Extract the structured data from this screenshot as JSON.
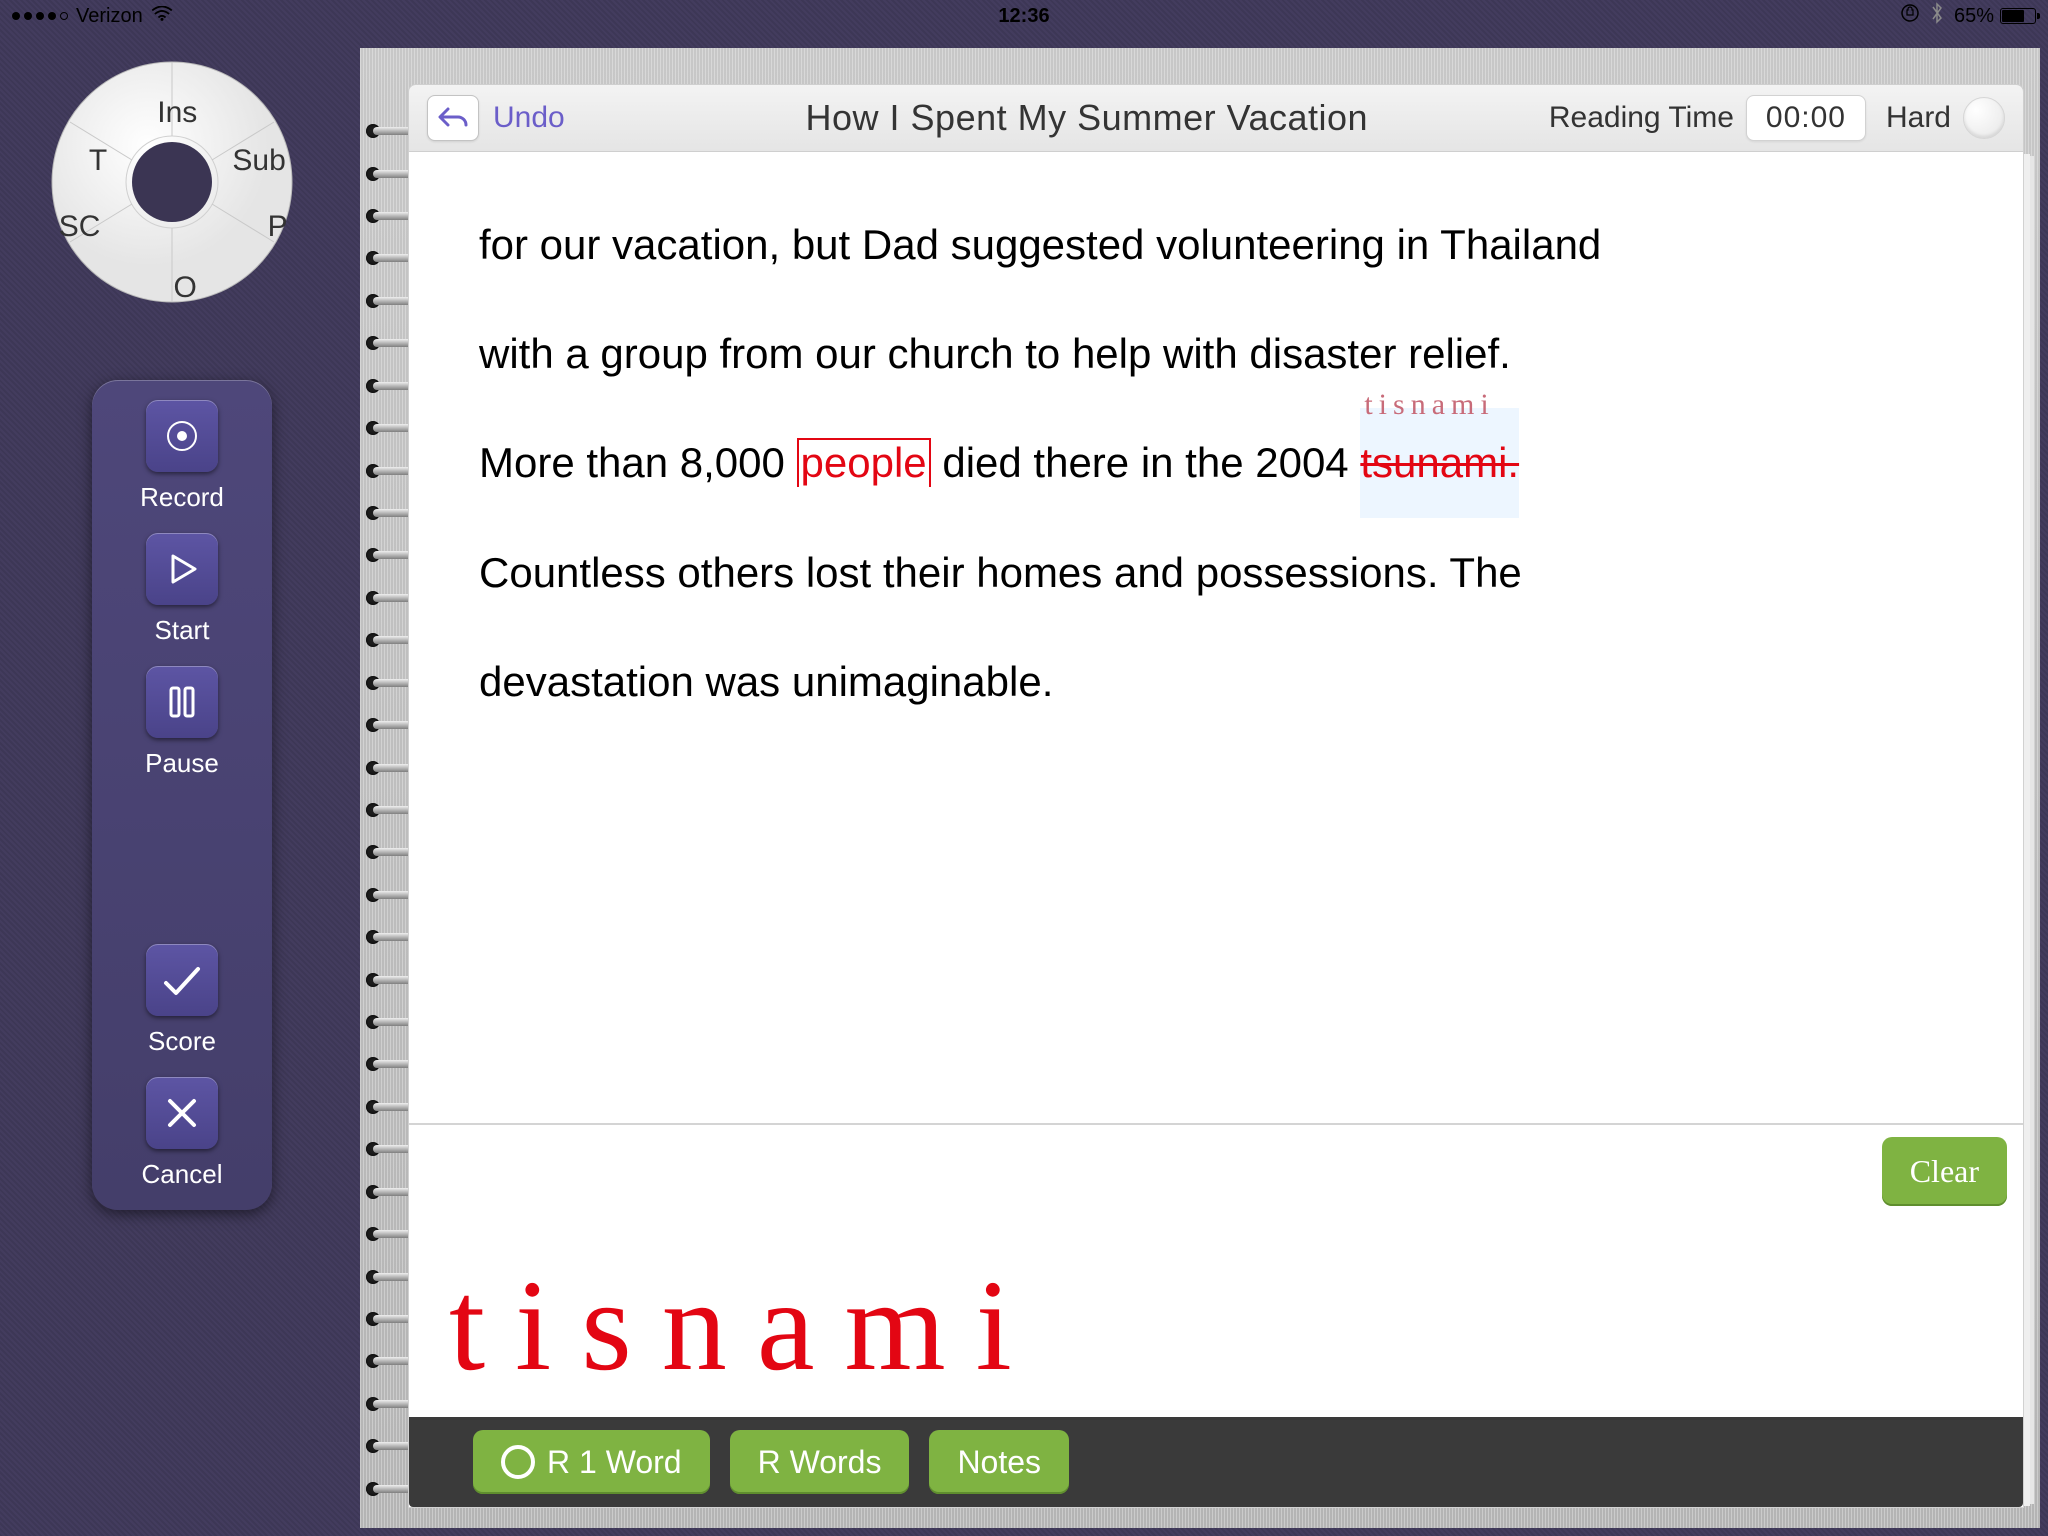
{
  "status": {
    "carrier": "Verizon",
    "time": "12:36",
    "battery_pct": "65%"
  },
  "radial": {
    "ins": "Ins",
    "sub": "Sub",
    "p": "P",
    "o": "O",
    "sc": "SC",
    "t": "T"
  },
  "sidebar": {
    "record": "Record",
    "start": "Start",
    "pause": "Pause",
    "score": "Score",
    "cancel": "Cancel"
  },
  "toolbar": {
    "undo": "Undo",
    "title": "How I Spent My Summer Vacation",
    "reading_time_label": "Reading Time",
    "reading_time_value": "00:00",
    "hard_label": "Hard"
  },
  "passage": {
    "line1_a": "for our vacation, but Dad suggested volunteering in Thailand",
    "line2": "with a group from our church to help with disaster relief.",
    "line3_a": "More than 8,000 ",
    "line3_mark": "people",
    "line3_b": " died there in the 2004 ",
    "line3_strike": "tsunami.",
    "line3_anno": "tisnami",
    "line4": "Countless others lost their homes and possessions. The",
    "line5": "devastation was unimaginable."
  },
  "scratch": {
    "entry": "tisnami",
    "clear": "Clear"
  },
  "bottom": {
    "r1": "R 1 Word",
    "rn": "R Words",
    "notes": "Notes"
  }
}
